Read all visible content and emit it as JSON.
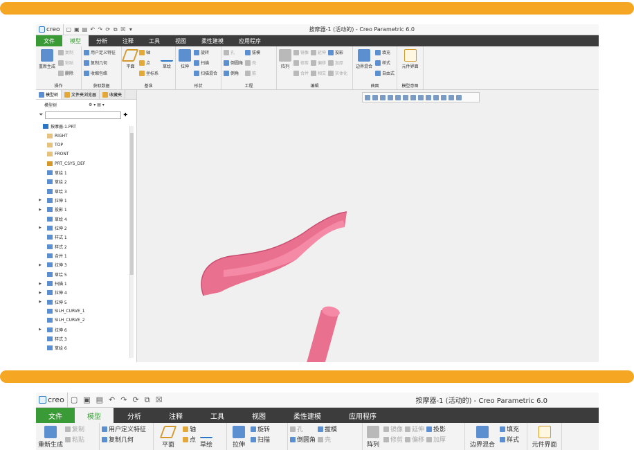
{
  "colors": {
    "orange": "#f5a623",
    "green": "#3a9a36",
    "dark": "#3c3c3c",
    "shape": "#e9708f",
    "shape_edge": "#c94f72"
  },
  "app": {
    "logo": "creo",
    "window_title": "按摩器-1 (活动的) - Creo Parametric 6.0"
  },
  "tabs": [
    "文件",
    "模型",
    "分析",
    "注释",
    "工具",
    "视图",
    "柔性建模",
    "应用程序"
  ],
  "ribbon": {
    "ops": {
      "regen": "重新生成",
      "copy": "复制",
      "paste": "粘贴",
      "delete": "删除",
      "name": "操作"
    },
    "get": {
      "udf": "用户定义特征",
      "copygeom": "复制几何",
      "shrink": "收缩包络",
      "name": "获取数据"
    },
    "datum": {
      "plane": "平面",
      "axis": "轴",
      "point": "点",
      "csys": "坐标系",
      "sketch": "草绘",
      "name": "基准"
    },
    "shape": {
      "extrude": "拉伸",
      "revolve": "旋转",
      "sweep": "扫描",
      "swpblend": "扫描混合",
      "name": "形状"
    },
    "eng": {
      "hole": "孔",
      "draft": "拔模",
      "round": "倒圆角",
      "shell": "壳",
      "chamfer": "倒角",
      "rib": "筋",
      "name": "工程"
    },
    "edit": {
      "pattern": "阵列",
      "mirror": "镜像",
      "extend": "延伸",
      "project": "投影",
      "trim": "修剪",
      "offset": "偏移",
      "thicken": "加厚",
      "merge": "合并",
      "intersect": "相交",
      "solidify": "实体化",
      "name": "编辑"
    },
    "surf": {
      "boundary": "边界混合",
      "fill": "填充",
      "style": "样式",
      "freestyle": "自由式",
      "name": "曲面"
    },
    "intent": {
      "elem": "元件界面",
      "name": "模型意图"
    }
  },
  "panel": {
    "tabs": [
      "模型树",
      "文件夹浏览器",
      "收藏夹"
    ],
    "header": "模型树",
    "tree": [
      {
        "label": "按摩器-1.PRT",
        "exp": ""
      },
      {
        "label": "RIGHT",
        "exp": ""
      },
      {
        "label": "TOP",
        "exp": ""
      },
      {
        "label": "FRONT",
        "exp": ""
      },
      {
        "label": "PRT_CSYS_DEF",
        "exp": ""
      },
      {
        "label": "草绘 1",
        "exp": ""
      },
      {
        "label": "草绘 2",
        "exp": ""
      },
      {
        "label": "草绘 3",
        "exp": ""
      },
      {
        "label": "拉伸 1",
        "exp": "▶"
      },
      {
        "label": "投影 1",
        "exp": "▶"
      },
      {
        "label": "草绘 4",
        "exp": ""
      },
      {
        "label": "拉伸 2",
        "exp": "▶"
      },
      {
        "label": "样式 1",
        "exp": ""
      },
      {
        "label": "样式 2",
        "exp": ""
      },
      {
        "label": "合并 1",
        "exp": ""
      },
      {
        "label": "拉伸 3",
        "exp": "▶"
      },
      {
        "label": "草绘 5",
        "exp": ""
      },
      {
        "label": "扫描 1",
        "exp": "▶"
      },
      {
        "label": "拉伸 4",
        "exp": "▶"
      },
      {
        "label": "拉伸 5",
        "exp": "▶"
      },
      {
        "label": "SILH_CURVE_1",
        "exp": ""
      },
      {
        "label": "SILH_CURVE_2",
        "exp": ""
      },
      {
        "label": "拉伸 6",
        "exp": "▶"
      },
      {
        "label": "样式 3",
        "exp": ""
      },
      {
        "label": "草绘 6",
        "exp": ""
      }
    ]
  }
}
